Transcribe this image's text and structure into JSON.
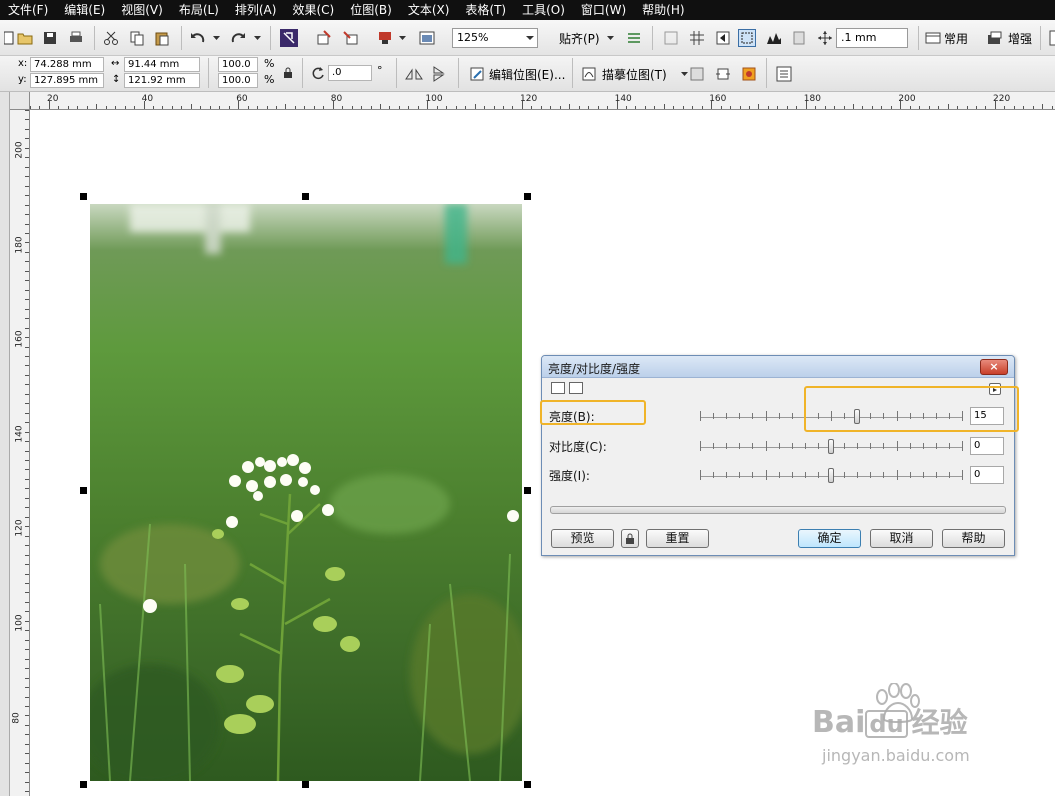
{
  "menu": [
    "文件(F)",
    "编辑(E)",
    "视图(V)",
    "布局(L)",
    "排列(A)",
    "效果(C)",
    "位图(B)",
    "文本(X)",
    "表格(T)",
    "工具(O)",
    "窗口(W)",
    "帮助(H)"
  ],
  "toolbar": {
    "zoom": "125%",
    "snap_label": "贴齐(P)",
    "nudge": ".1 mm",
    "common_label": "常用",
    "enhance_label": "增强"
  },
  "propbar": {
    "x_label": "x:",
    "x": "74.288 mm",
    "y_label": "y:",
    "y": "127.895 mm",
    "w": "91.44 mm",
    "h": "121.92 mm",
    "sx": "100.0",
    "sy": "100.0",
    "pct1": "%",
    "pct2": "%",
    "angle": ".0",
    "deg": "°",
    "edit_bitmap": "编辑位图(E)...",
    "trace_bitmap": "描摹位图(T)"
  },
  "ruler": {
    "h_labels": [
      "20",
      "40",
      "60",
      "80",
      "100",
      "120",
      "140",
      "160",
      "180",
      "200",
      "220"
    ],
    "v_labels": [
      "200",
      "180",
      "160",
      "140",
      "120",
      "100",
      "80"
    ]
  },
  "dialog": {
    "title": "亮度/对比度/强度",
    "rows": [
      {
        "label": "亮度(B):",
        "value": "15",
        "level": 0.6
      },
      {
        "label": "对比度(C):",
        "value": "0",
        "level": 0.5
      },
      {
        "label": "强度(I):",
        "value": "0",
        "level": 0.5
      }
    ],
    "buttons": {
      "preview": "预览",
      "reset": "重置",
      "ok": "确定",
      "cancel": "取消",
      "help": "帮助"
    },
    "close": "×"
  },
  "watermark": {
    "brand_bai": "Bai",
    "brand_du": "du",
    "brand_cn": "经验",
    "url": "jingyan.baidu.com"
  },
  "colors": {
    "menubar": "#101010",
    "highlight": "#f0b429",
    "dialog_border": "#6d8db5"
  }
}
